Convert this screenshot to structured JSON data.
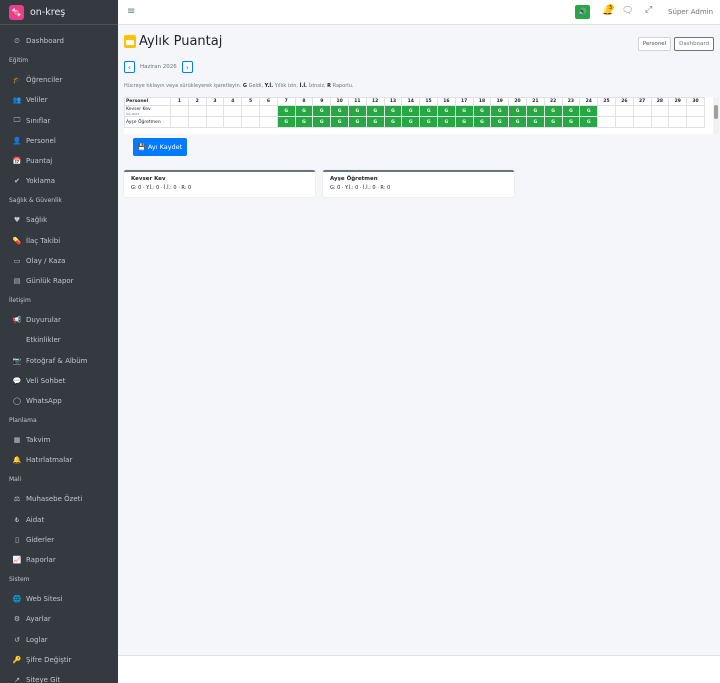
{
  "brand": {
    "logo": "🍬",
    "name": "on-kreş"
  },
  "sidebar": {
    "items": [
      {
        "type": "item",
        "icon": "⏲",
        "icon_name": "dashboard-icon",
        "label": "Dashboard"
      },
      {
        "type": "header",
        "label": "Eğitim"
      },
      {
        "type": "item",
        "icon": "🎓",
        "icon_name": "graduation-icon",
        "label": "Öğrenciler"
      },
      {
        "type": "item",
        "icon": "👥",
        "icon_name": "users-icon",
        "label": "Veliler"
      },
      {
        "type": "item",
        "icon": "🖵",
        "icon_name": "classroom-icon",
        "label": "Sınıflar"
      },
      {
        "type": "item",
        "icon": "👤",
        "icon_name": "staff-icon",
        "label": "Personel"
      },
      {
        "type": "item",
        "icon": "📅",
        "icon_name": "calendar-check-icon",
        "label": "Puantaj"
      },
      {
        "type": "item",
        "icon": "✔",
        "icon_name": "user-check-icon",
        "label": "Yoklama"
      },
      {
        "type": "header",
        "label": "Sağlık & Güvenlik"
      },
      {
        "type": "item",
        "icon": "♥",
        "icon_name": "heartbeat-icon",
        "label": "Sağlık"
      },
      {
        "type": "item",
        "icon": "💊",
        "icon_name": "pills-icon",
        "label": "İlaç Takibi"
      },
      {
        "type": "item",
        "icon": "▭",
        "icon_name": "incident-icon",
        "label": "Olay / Kaza"
      },
      {
        "type": "item",
        "icon": "▤",
        "icon_name": "report-icon",
        "label": "Günlük Rapor"
      },
      {
        "type": "header",
        "label": "İletişim"
      },
      {
        "type": "item",
        "icon": "📢",
        "icon_name": "megaphone-icon",
        "label": "Duyurular"
      },
      {
        "type": "item",
        "icon": "",
        "icon_name": "",
        "label": "Etkinlikler"
      },
      {
        "type": "item",
        "icon": "📷",
        "icon_name": "camera-icon",
        "label": "Fotoğraf & Albüm"
      },
      {
        "type": "item",
        "icon": "💬",
        "icon_name": "chat-icon",
        "label": "Veli Sohbet"
      },
      {
        "type": "item",
        "icon": "◯",
        "icon_name": "whatsapp-icon",
        "label": "WhatsApp"
      },
      {
        "type": "header",
        "label": "Planlama"
      },
      {
        "type": "item",
        "icon": "▦",
        "icon_name": "calendar-icon",
        "label": "Takvim"
      },
      {
        "type": "item",
        "icon": "🔔",
        "icon_name": "bell-icon",
        "label": "Hatırlatmalar"
      },
      {
        "type": "header",
        "label": "Mali"
      },
      {
        "type": "item",
        "icon": "⚖",
        "icon_name": "balance-icon",
        "label": "Muhasebe Özeti"
      },
      {
        "type": "item",
        "icon": "₺",
        "icon_name": "lira-icon",
        "label": "Aidat"
      },
      {
        "type": "item",
        "icon": "▯",
        "icon_name": "expense-icon",
        "label": "Giderler"
      },
      {
        "type": "item",
        "icon": "📈",
        "icon_name": "chart-icon",
        "label": "Raporlar"
      },
      {
        "type": "header",
        "label": "Sistem"
      },
      {
        "type": "item",
        "icon": "🌐",
        "icon_name": "globe-icon",
        "label": "Web Sitesi"
      },
      {
        "type": "item",
        "icon": "⚙",
        "icon_name": "gear-icon",
        "label": "Ayarlar"
      },
      {
        "type": "item",
        "icon": "↺",
        "icon_name": "history-icon",
        "label": "Loglar"
      },
      {
        "type": "item",
        "icon": "🔑",
        "icon_name": "key-icon",
        "label": "Şifre Değiştir"
      },
      {
        "type": "item",
        "icon": "↗",
        "icon_name": "external-link-icon",
        "label": "Siteye Git"
      }
    ]
  },
  "topbar": {
    "menu_icon": "≡",
    "sound_icon": "🔊",
    "bell_icon": "🔔",
    "bell_badge": "3",
    "chat_icon": "🗨",
    "expand_icon": "⤢",
    "user": "Süper Admin"
  },
  "page": {
    "title": "Aylık Puantaj",
    "tabs": [
      "Personel",
      "Dashboard"
    ],
    "month": "Haziran 2026",
    "prev": "‹",
    "next": "›",
    "hint_parts": [
      "Hücreye tıklayın veya sürükleyerek işaretleyin. ",
      "G",
      " Geldi, ",
      "Y.İ.",
      " Yıllık izin, ",
      "İ.İ.",
      " İzinsiz, ",
      "R",
      " Raporlu."
    ],
    "save_icon": "💾",
    "save_label": "Ayı Kaydet"
  },
  "grid": {
    "name_header": "Personel",
    "days": 30,
    "rows": [
      {
        "name": "Kevser Kev",
        "sub": "ÖĞ.0001",
        "marks": [
          "",
          "",
          "",
          "",
          "",
          "",
          "G",
          "G",
          "G",
          "G",
          "G",
          "G",
          "G",
          "G",
          "G",
          "G",
          "G",
          "G",
          "G",
          "G",
          "G",
          "G",
          "G",
          "G",
          "",
          "",
          "",
          "",
          "",
          ""
        ]
      },
      {
        "name": "Ayşe Öğretmen",
        "sub": "",
        "marks": [
          "",
          "",
          "",
          "",
          "",
          "",
          "G",
          "G",
          "G",
          "G",
          "G",
          "G",
          "G",
          "G",
          "G",
          "G",
          "G",
          "G",
          "G",
          "G",
          "G",
          "G",
          "G",
          "G",
          "",
          "",
          "",
          "",
          "",
          ""
        ]
      }
    ]
  },
  "cards": [
    {
      "name": "Kevser Kev",
      "summary": "G: 0 · Y.İ.: 0 · İ.İ.: 0 · R: 0"
    },
    {
      "name": "Ayşe Öğretmen",
      "summary": "G: 0 · Y.İ.: 0 · İ.İ.: 0 · R: 0"
    }
  ],
  "colors": {
    "present": "#28a745",
    "primary": "#007bff",
    "sidebar": "#343a40",
    "brand": "#e83e8c"
  }
}
